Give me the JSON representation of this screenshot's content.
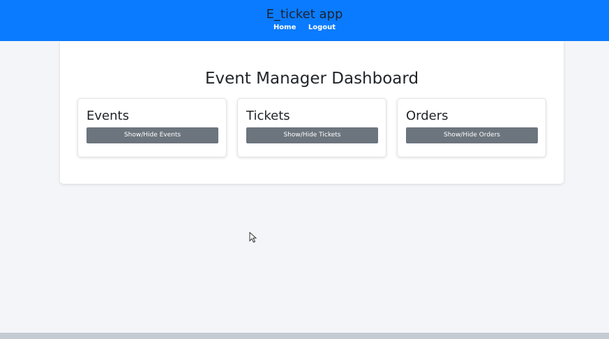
{
  "navbar": {
    "app_title": "E_ticket app",
    "links": [
      {
        "label": "Home"
      },
      {
        "label": "Logout"
      }
    ],
    "color": "#0a7bff"
  },
  "dashboard": {
    "title": "Event Manager Dashboard",
    "panels": [
      {
        "title": "Events",
        "button_label": "Show/Hide Events"
      },
      {
        "title": "Tickets",
        "button_label": "Show/Hide Tickets"
      },
      {
        "title": "Orders",
        "button_label": "Show/Hide Orders"
      }
    ],
    "button_color": "#6c757d"
  },
  "cursor": {
    "icon": "mouse-pointer-icon"
  }
}
